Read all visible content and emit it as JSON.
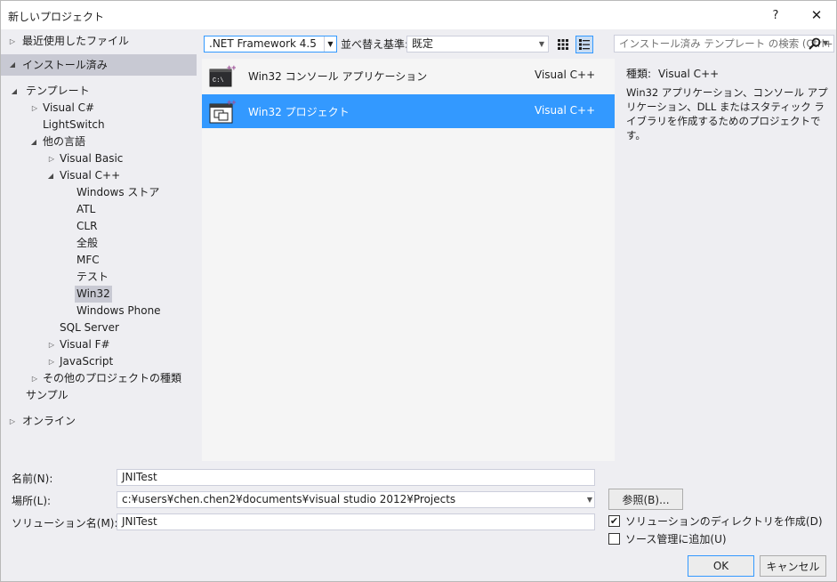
{
  "window": {
    "title": "新しいプロジェクト",
    "help_label": "?",
    "close_label": "✕"
  },
  "tree": {
    "recent": "最近使用したファイル",
    "installed": "インストール済み",
    "templates": "テンプレート",
    "visual_csharp": "Visual C#",
    "lightswitch": "LightSwitch",
    "other_languages": "他の言語",
    "visual_basic": "Visual Basic",
    "visual_cpp": "Visual C++",
    "windows_store": "Windows ストア",
    "atl": "ATL",
    "clr": "CLR",
    "general": "全般",
    "mfc": "MFC",
    "test": "テスト",
    "win32": "Win32",
    "windows_phone": "Windows Phone",
    "sql_server": "SQL Server",
    "visual_fsharp": "Visual F#",
    "javascript": "JavaScript",
    "other_project_types": "その他のプロジェクトの種類",
    "samples": "サンプル",
    "online": "オンライン"
  },
  "toolbar": {
    "framework": ".NET Framework 4.5",
    "sort_label": "並べ替え基準:",
    "sort_value": "既定"
  },
  "templates": [
    {
      "name": "Win32 コンソール アプリケーション",
      "language": "Visual C++",
      "icon": "console-app-icon"
    },
    {
      "name": "Win32 プロジェクト",
      "language": "Visual C++",
      "icon": "win32-project-icon"
    }
  ],
  "search": {
    "placeholder": "インストール済み テンプレート の検索 (Ctrl+E)"
  },
  "details": {
    "type_label": "種類:",
    "type_value": "Visual C++",
    "description": "Win32 アプリケーション、コンソール アプリケーション、DLL またはスタティック ライブラリを作成するためのプロジェクトです。"
  },
  "form": {
    "name_label": "名前(N):",
    "name_value": "JNITest",
    "location_label": "場所(L):",
    "location_value": "c:¥users¥chen.chen2¥documents¥visual studio 2012¥Projects",
    "solution_label": "ソリューション名(M):",
    "solution_value": "JNITest",
    "browse_label": "参照(B)...",
    "create_dir_label": "ソリューションのディレクトリを作成(D)",
    "create_dir_checked": true,
    "source_control_label": "ソース管理に追加(U)",
    "source_control_checked": false,
    "ok_label": "OK",
    "cancel_label": "キャンセル"
  },
  "colors": {
    "accent": "#3399ff",
    "selection_inactive": "#c8c9d3",
    "panel_bg": "#eeeef2"
  }
}
